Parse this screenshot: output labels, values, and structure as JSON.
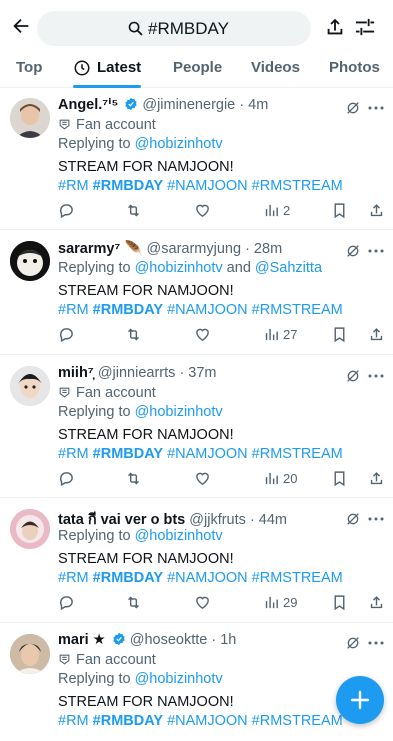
{
  "search": {
    "query": "#RMBDAY"
  },
  "tabs": [
    "Top",
    "Latest",
    "People",
    "Videos",
    "Photos"
  ],
  "fan_label": "Fan account",
  "tweets": [
    {
      "name": "Angel.⁷ⁱ⁵",
      "handle": "@jiminenergie",
      "time": "· 4m",
      "replying_prefix": "Replying to ",
      "replying_to": "@hobizinhotv",
      "replying_joiner": "",
      "replying_to_2": "",
      "text": "STREAM FOR NAMJOON!",
      "hashtags": [
        "#RM",
        "#RMBDAY",
        "#NAMJOON",
        "#RMSTREAM"
      ],
      "views": "2"
    },
    {
      "name": "sararmy⁷ 🪶",
      "handle": "@sararmyjung",
      "time": "· 28m",
      "replying_prefix": "Replying to ",
      "replying_to": "@hobizinhotv",
      "replying_joiner": " and ",
      "replying_to_2": "@Sahzitta",
      "text": "STREAM FOR NAMJOON!",
      "hashtags": [
        "#RM",
        "#RMBDAY",
        "#NAMJOON",
        "#RMSTREAM"
      ],
      "views": "27"
    },
    {
      "name": "miih⁷̦",
      "handle": "@jinniearrts",
      "time": "· 37m",
      "replying_prefix": "Replying to ",
      "replying_to": "@hobizinhotv",
      "replying_joiner": "",
      "replying_to_2": "",
      "text": "STREAM FOR NAMJOON!",
      "hashtags": [
        "#RM",
        "#RMBDAY",
        "#NAMJOON",
        "#RMSTREAM"
      ],
      "views": "20"
    },
    {
      "name": "tata กี vai ver o bts",
      "handle": "@jjkfruts",
      "time": "· 44m",
      "replying_prefix": "Replying to ",
      "replying_to": "@hobizinhotv",
      "replying_joiner": "",
      "replying_to_2": "",
      "text": "STREAM FOR NAMJOON!",
      "hashtags": [
        "#RM",
        "#RMBDAY",
        "#NAMJOON",
        "#RMSTREAM"
      ],
      "views": "29"
    },
    {
      "name": "mari ★",
      "handle": "@hoseoktte",
      "time": "· 1h",
      "replying_prefix": "Replying to ",
      "replying_to": "@hobizinhotv",
      "replying_joiner": "",
      "replying_to_2": "",
      "text": "STREAM FOR NAMJOON!",
      "hashtags": [
        "#RM",
        "#RMBDAY",
        "#NAMJOON",
        "#RMSTREAM"
      ],
      "views": ""
    }
  ],
  "colors": {
    "accent": "#1d9bf0",
    "text": "#0f1419",
    "muted": "#536471"
  },
  "icons": [
    "back-arrow-icon",
    "search-icon",
    "share-icon",
    "filter-icon",
    "clock-icon",
    "verified-icon",
    "grok-icon",
    "more-icon",
    "reply-icon",
    "retweet-icon",
    "like-icon",
    "views-icon",
    "bookmark-icon",
    "compose-plus-icon"
  ]
}
